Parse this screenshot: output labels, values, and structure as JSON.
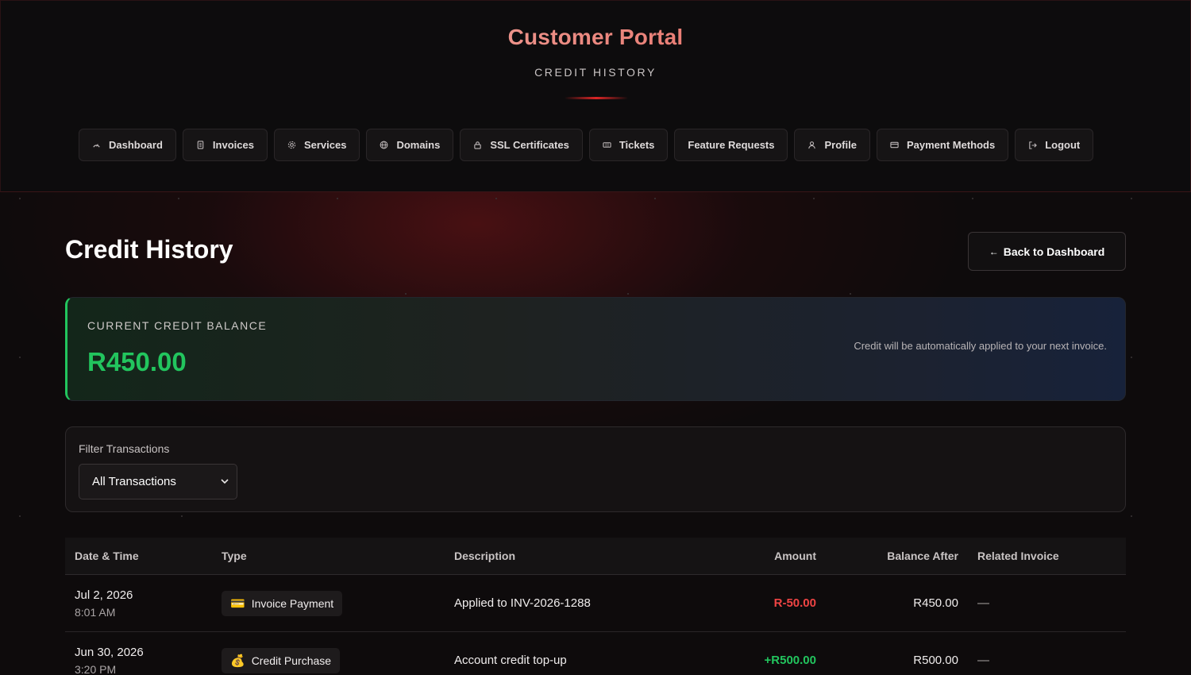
{
  "header": {
    "brand": "Customer Portal",
    "subtitle": "CREDIT HISTORY"
  },
  "nav": [
    {
      "label": "Dashboard",
      "icon": "dashboard-gauge-icon"
    },
    {
      "label": "Invoices",
      "icon": "document-icon"
    },
    {
      "label": "Services",
      "icon": "gear-icon"
    },
    {
      "label": "Domains",
      "icon": "globe-icon"
    },
    {
      "label": "SSL Certificates",
      "icon": "lock-icon"
    },
    {
      "label": "Tickets",
      "icon": "ticket-icon"
    },
    {
      "label": "Feature Requests",
      "icon": ""
    },
    {
      "label": "Profile",
      "icon": "user-icon"
    },
    {
      "label": "Payment Methods",
      "icon": "credit-card-icon"
    },
    {
      "label": "Logout",
      "icon": "logout-icon"
    }
  ],
  "page": {
    "title": "Credit History",
    "back_label": "Back to Dashboard",
    "back_arrow": "←"
  },
  "balance": {
    "label": "CURRENT CREDIT BALANCE",
    "amount": "R450.00",
    "note": "Credit will be automatically applied to your next invoice."
  },
  "filter": {
    "label": "Filter Transactions",
    "selected": "All Transactions"
  },
  "table": {
    "columns": [
      "Date & Time",
      "Type",
      "Description",
      "Amount",
      "Balance After",
      "Related Invoice"
    ],
    "rows": [
      {
        "date": "Jul 2, 2026",
        "time": "8:01 AM",
        "type_emoji": "💳",
        "type": "Invoice Payment",
        "description": "Applied to INV-2026-1288",
        "amount": "R-50.00",
        "balance_after": "R450.00",
        "related_invoice": "—"
      },
      {
        "date": "Jun 30, 2026",
        "time": "3:20 PM",
        "type_emoji": "💰",
        "type": "Credit Purchase",
        "description": "Account credit top-up",
        "amount": "+R500.00",
        "balance_after": "R500.00",
        "related_invoice": "—"
      }
    ]
  },
  "colors": {
    "accent_red": "#dc2626",
    "positive_green": "#22c55e",
    "negative_red": "#ef4444"
  }
}
